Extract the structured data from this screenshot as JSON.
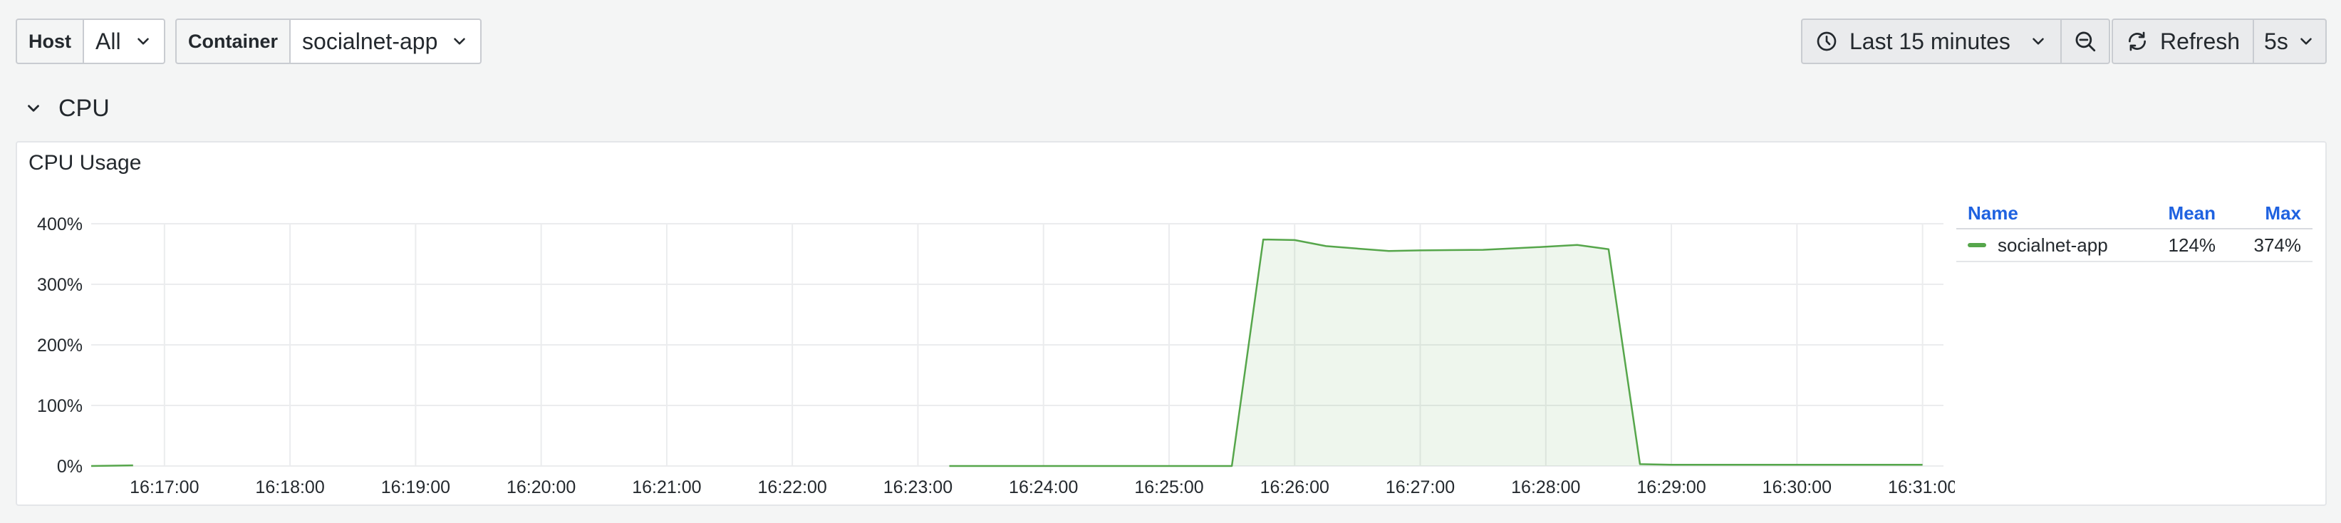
{
  "variables": {
    "host": {
      "label": "Host",
      "value": "All"
    },
    "container": {
      "label": "Container",
      "value": "socialnet-app"
    }
  },
  "time_picker": {
    "range_label": "Last 15 minutes",
    "clock_icon": "clock-icon",
    "zoom_out_icon": "zoom-out-icon"
  },
  "refresh": {
    "label": "Refresh",
    "interval": "5s",
    "icon": "refresh-icon"
  },
  "row": {
    "title": "CPU",
    "collapse_icon": "chevron-down-icon"
  },
  "panel": {
    "title": "CPU Usage",
    "legend": {
      "columns": [
        "Name",
        "Mean",
        "Max"
      ],
      "rows": [
        {
          "name": "socialnet-app",
          "mean": "124%",
          "max": "374%",
          "color": "#56a64b"
        }
      ]
    }
  },
  "chart_data": {
    "type": "area",
    "title": "CPU Usage",
    "y_ticks": [
      "0%",
      "100%",
      "200%",
      "300%",
      "400%"
    ],
    "ylim": [
      0,
      400
    ],
    "x_ticks": [
      "16:17:00",
      "16:18:00",
      "16:19:00",
      "16:20:00",
      "16:21:00",
      "16:22:00",
      "16:23:00",
      "16:24:00",
      "16:25:00",
      "16:26:00",
      "16:27:00",
      "16:28:00",
      "16:29:00",
      "16:30:00",
      "16:31:00"
    ],
    "xlim": [
      "16:16:25",
      "16:31:10"
    ],
    "grid": true,
    "legend_position": "right",
    "series": [
      {
        "name": "socialnet-app",
        "color": "#56a64b",
        "segments": [
          [
            [
              "16:16:25",
              0
            ],
            [
              "16:16:45",
              1
            ]
          ],
          [
            [
              "16:23:15",
              0
            ],
            [
              "16:24:00",
              0
            ],
            [
              "16:25:00",
              0
            ],
            [
              "16:25:30",
              0
            ],
            [
              "16:25:45",
              374
            ],
            [
              "16:26:00",
              373
            ],
            [
              "16:26:15",
              363
            ],
            [
              "16:26:45",
              355
            ],
            [
              "16:27:00",
              356
            ],
            [
              "16:27:30",
              357
            ],
            [
              "16:28:00",
              362
            ],
            [
              "16:28:15",
              365
            ],
            [
              "16:28:30",
              358
            ],
            [
              "16:28:45",
              3
            ],
            [
              "16:29:00",
              2
            ],
            [
              "16:30:00",
              2
            ],
            [
              "16:31:00",
              2
            ]
          ]
        ]
      }
    ]
  }
}
